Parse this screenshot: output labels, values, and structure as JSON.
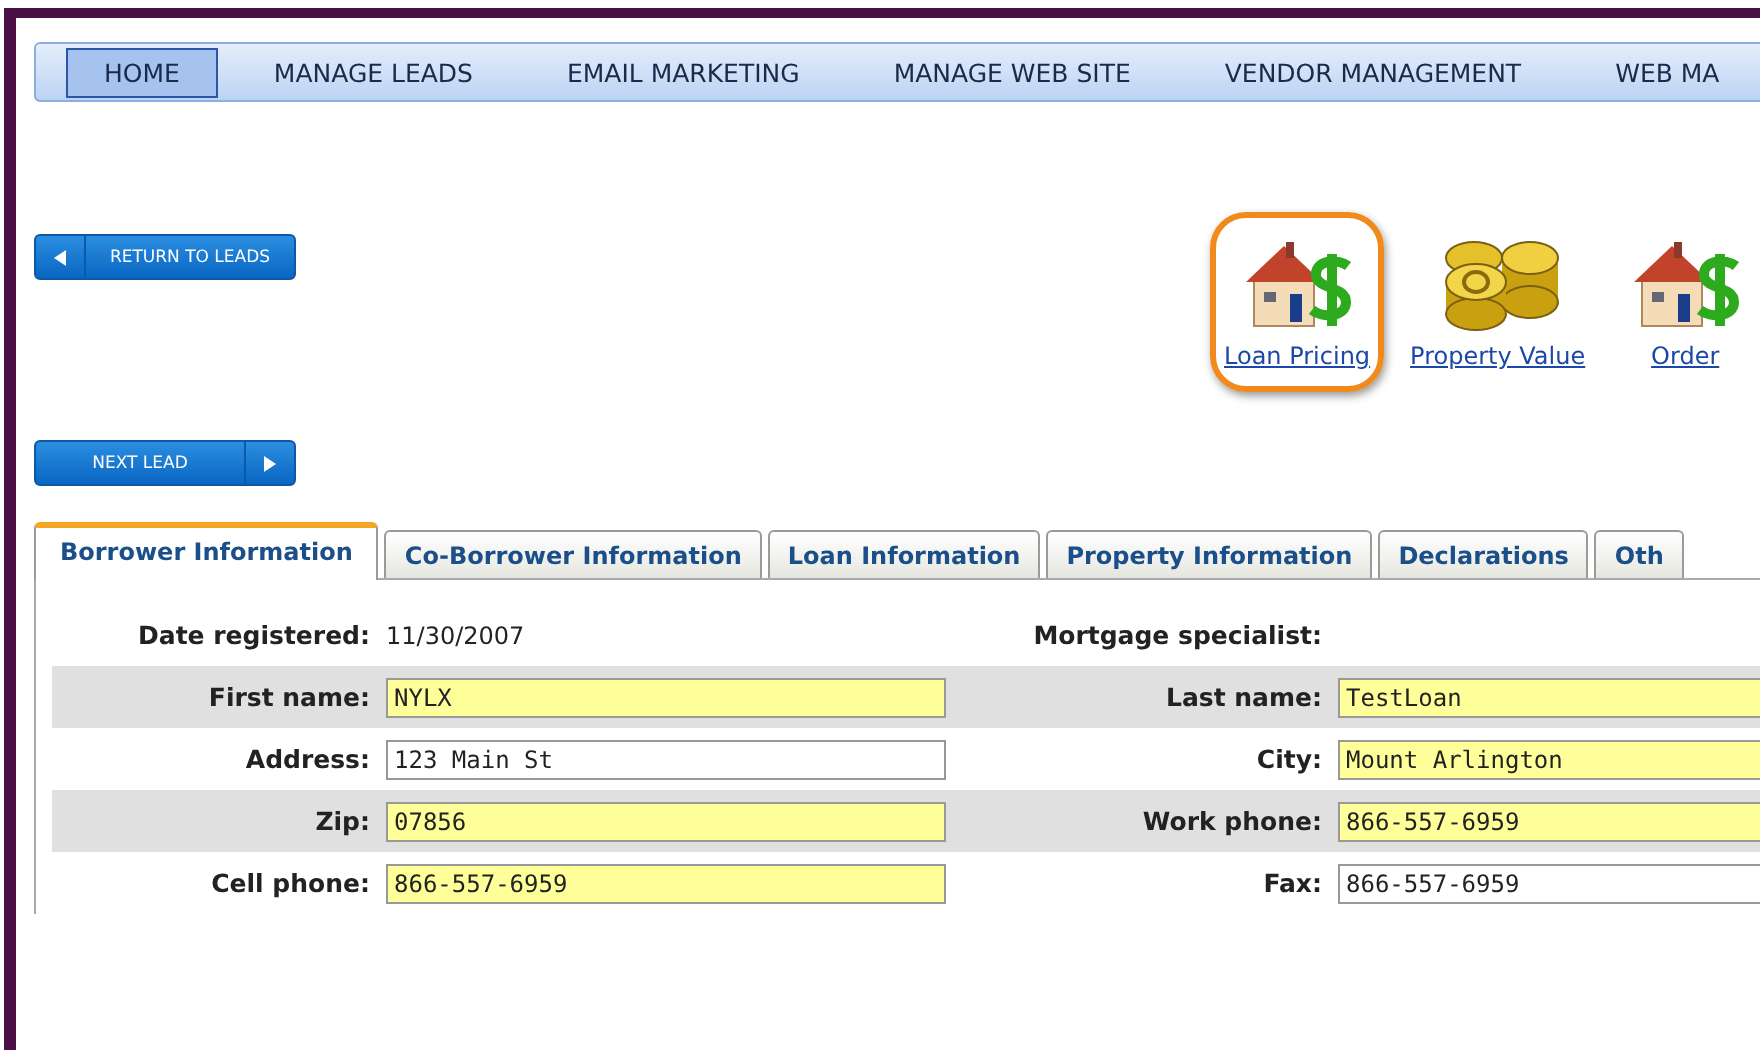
{
  "nav": [
    {
      "label": "HOME",
      "selected": true
    },
    {
      "label": "MANAGE LEADS",
      "selected": false
    },
    {
      "label": "EMAIL MARKETING",
      "selected": false
    },
    {
      "label": "MANAGE WEB SITE",
      "selected": false
    },
    {
      "label": "VENDOR MANAGEMENT",
      "selected": false
    },
    {
      "label": "WEB MA",
      "selected": false
    }
  ],
  "return_button": "RETURN TO LEADS",
  "next_button": "NEXT LEAD",
  "tools": [
    {
      "kind": "house",
      "label": "Loan Pricing",
      "selected": true
    },
    {
      "kind": "coins",
      "label": "Property Value",
      "selected": false
    },
    {
      "kind": "house",
      "label": "Order",
      "selected": false
    }
  ],
  "tabs": [
    {
      "label": "Borrower Information",
      "selected": true
    },
    {
      "label": "Co-Borrower Information",
      "selected": false
    },
    {
      "label": "Loan Information",
      "selected": false
    },
    {
      "label": "Property Information",
      "selected": false
    },
    {
      "label": "Declarations",
      "selected": false
    },
    {
      "label": "Oth",
      "selected": false
    }
  ],
  "header_row": {
    "date_label": "Date registered:",
    "date_value": "11/30/2007",
    "specialist_label": "Mortgage specialist:"
  },
  "rows": [
    {
      "fields": [
        {
          "label": "First name:",
          "value": "NYLX",
          "highlighted": true
        },
        {
          "label": "Last name:",
          "value": "TestLoan",
          "highlighted": true
        }
      ]
    },
    {
      "fields": [
        {
          "label": "Address:",
          "value": "123 Main St",
          "highlighted": false
        },
        {
          "label": "City:",
          "value": "Mount Arlington",
          "highlighted": true
        }
      ]
    },
    {
      "fields": [
        {
          "label": "Zip:",
          "value": "07856",
          "highlighted": true
        },
        {
          "label": "Work phone:",
          "value": "866-557-6959",
          "highlighted": true
        }
      ]
    },
    {
      "fields": [
        {
          "label": "Cell phone:",
          "value": "866-557-6959",
          "highlighted": true
        },
        {
          "label": "Fax:",
          "value": "866-557-6959",
          "highlighted": false
        }
      ]
    }
  ]
}
